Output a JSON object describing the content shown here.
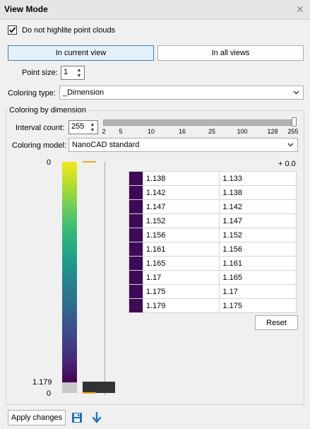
{
  "window": {
    "title": "View Mode",
    "close_icon": "close-icon"
  },
  "highlight": {
    "label": "Do not highlite point clouds",
    "checked": true
  },
  "view_buttons": {
    "current": "In current view",
    "all": "In all views",
    "active": "current"
  },
  "point_size": {
    "label": "Point size:",
    "value": "1"
  },
  "coloring_type": {
    "label": "Coloring type:",
    "value": "_Dimension"
  },
  "group": {
    "title": "Coloring by dimension",
    "interval": {
      "label": "Interval count:",
      "value": "255",
      "slider_ticks": [
        "2",
        "5",
        "10",
        "16",
        "25",
        "100",
        "128",
        "255"
      ]
    },
    "model": {
      "label": "Coloring model:",
      "value": "NanoCAD standard"
    },
    "scale": {
      "top": "0",
      "mid": "1.179",
      "bottom": "0"
    },
    "offset_label": "+ 0.0",
    "table": {
      "swatch_color": "#3d0a57",
      "rows": [
        [
          "1.138",
          "1.133"
        ],
        [
          "1.142",
          "1.138"
        ],
        [
          "1.147",
          "1.142"
        ],
        [
          "1.152",
          "1.147"
        ],
        [
          "1.156",
          "1.152"
        ],
        [
          "1.161",
          "1.156"
        ],
        [
          "1.165",
          "1.161"
        ],
        [
          "1.17",
          "1.165"
        ],
        [
          "1.175",
          "1.17"
        ],
        [
          "1.179",
          "1.175"
        ]
      ]
    },
    "reset_label": "Reset"
  },
  "footer": {
    "apply_label": "Apply changes",
    "save_icon": "save-icon",
    "download_icon": "download-arrow-icon"
  },
  "colors": {
    "accent": "#3c7fb1",
    "colorbar_top": "#f0e624",
    "colorbar_mid": "#25858e",
    "colorbar_bottom": "#3d0a57",
    "marker": "#f5a623"
  }
}
